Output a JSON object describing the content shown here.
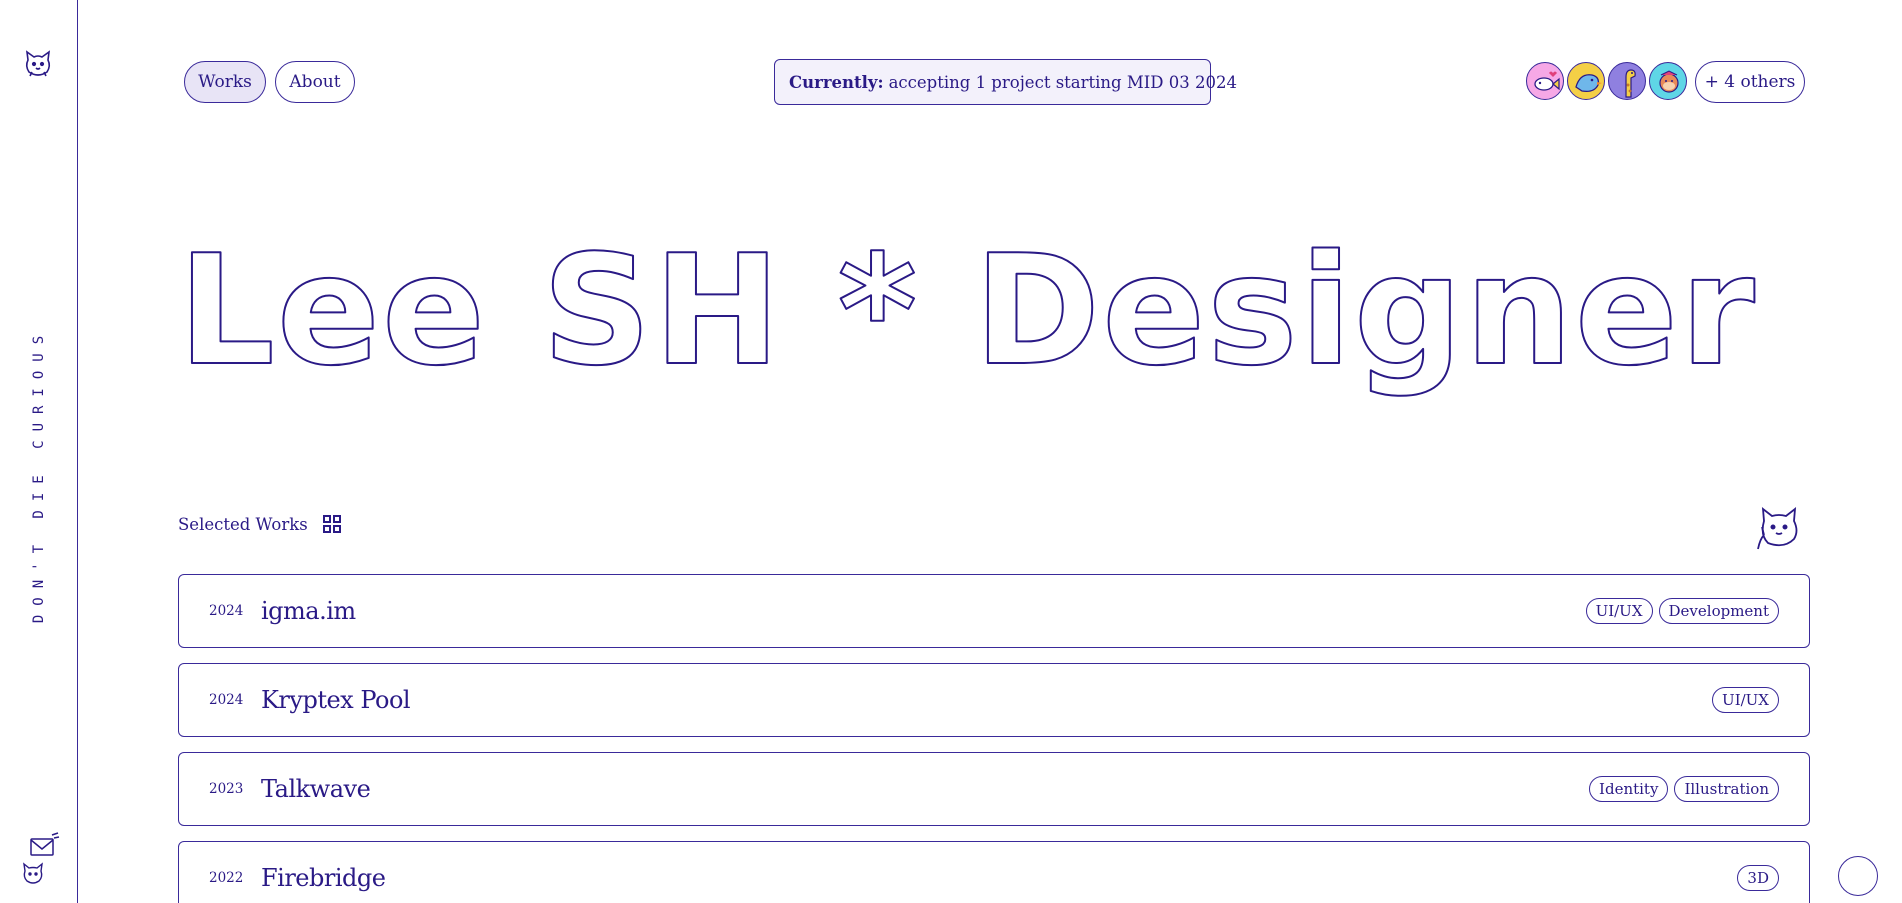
{
  "sidebar": {
    "tagline": "DON'T DIE CURIOUS"
  },
  "nav": {
    "works_label": "Works",
    "about_label": "About"
  },
  "status": {
    "prefix": "Currently:",
    "text": "accepting 1 project starting MID 03 2024"
  },
  "avatars": {
    "items": [
      {
        "name": "fish-avatar",
        "bg": "#f6a8e6"
      },
      {
        "name": "bird-avatar",
        "bg": "#f4cf46"
      },
      {
        "name": "giraffe-avatar",
        "bg": "#8f80e0"
      },
      {
        "name": "monkey-avatar",
        "bg": "#5fd6e6"
      }
    ],
    "others_label": "+ 4 others"
  },
  "hero": {
    "marquee_text": "Lee SH * Designer * Designer"
  },
  "selected": {
    "label": "Selected Works"
  },
  "works": [
    {
      "year": "2024",
      "title": "igma.im",
      "tags": [
        "UI/UX",
        "Development"
      ]
    },
    {
      "year": "2024",
      "title": "Kryptex Pool",
      "tags": [
        "UI/UX"
      ]
    },
    {
      "year": "2023",
      "title": "Talkwave",
      "tags": [
        "Identity",
        "Illustration"
      ]
    },
    {
      "year": "2022",
      "title": "Firebridge",
      "tags": [
        "3D"
      ]
    }
  ],
  "colors": {
    "ink": "#2a1a86",
    "active_pill": "#e8e4f6"
  }
}
